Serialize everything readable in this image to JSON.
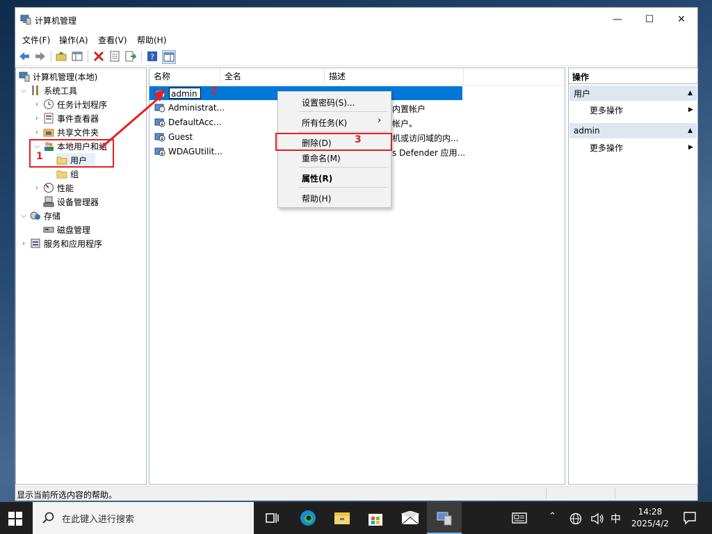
{
  "window": {
    "title": "计算机管理",
    "minimize_glyph": "—",
    "maximize_glyph": "☐",
    "close_glyph": "✕"
  },
  "menu": [
    "文件(F)",
    "操作(A)",
    "查看(V)",
    "帮助(H)"
  ],
  "toolbar": {
    "icons": [
      "back-arrow-icon",
      "forward-arrow-icon",
      "up-folder-icon",
      "show-hide-tree-icon",
      "delete-icon",
      "properties-icon",
      "export-list-icon",
      "help-icon",
      "show-action-pane-icon"
    ]
  },
  "tree": {
    "root": "计算机管理(本地)",
    "system_tools": "系统工具",
    "task_scheduler": "任务计划程序",
    "event_viewer": "事件查看器",
    "shared_folders": "共享文件夹",
    "local_users_groups": "本地用户和组",
    "users": "用户",
    "groups": "组",
    "performance": "性能",
    "device_manager": "设备管理器",
    "storage": "存储",
    "disk_management": "磁盘管理",
    "services_apps": "服务和应用程序"
  },
  "list": {
    "columns": [
      "名称",
      "全名",
      "描述"
    ],
    "rows": [
      {
        "name": "admin",
        "fullname": "",
        "desc": ""
      },
      {
        "name": "Administrat...",
        "fullname": "",
        "desc": "内置帐户"
      },
      {
        "name": "DefaultAcc...",
        "fullname": "",
        "desc": "帐户。"
      },
      {
        "name": "Guest",
        "fullname": "",
        "desc": "机或访问域的内..."
      },
      {
        "name": "WDAGUtilit...",
        "fullname": "",
        "desc": "s Defender 应用..."
      }
    ]
  },
  "context_menu": {
    "set_password": "设置密码(S)...",
    "all_tasks": "所有任务(K)",
    "delete": "删除(D)",
    "rename": "重命名(M)",
    "properties": "属性(R)",
    "help": "帮助(H)"
  },
  "actions": {
    "title": "操作",
    "group1": "用户",
    "more1": "更多操作",
    "group2": "admin",
    "more2": "更多操作"
  },
  "statusbar": {
    "text": "显示当前所选内容的帮助。"
  },
  "annotations": {
    "n1": "1",
    "n2": "2",
    "n3": "3",
    "color": "#e02020"
  },
  "taskbar": {
    "search_placeholder": "在此键入进行搜索",
    "ime": "中",
    "time": "14:28",
    "date": "2025/4/2"
  }
}
